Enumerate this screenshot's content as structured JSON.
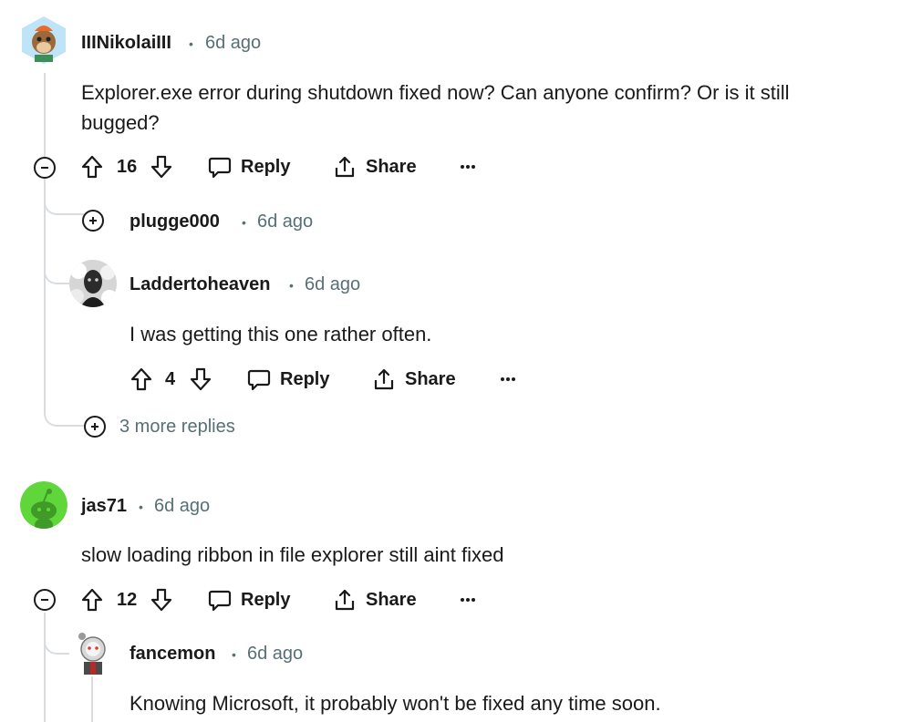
{
  "comments": [
    {
      "username": "IIINikolaiIII",
      "time": "6d ago",
      "body_lines": [
        "Explorer.exe error during shutdown fixed now? Can anyone confirm? Or is it still",
        "bugged?"
      ],
      "votes": "16",
      "reply_label": "Reply",
      "share_label": "Share"
    },
    {
      "username": "plugge000",
      "time": "6d ago",
      "collapsed": true
    },
    {
      "username": "Laddertoheaven",
      "time": "6d ago",
      "body": "I was getting this one rather often.",
      "votes": "4",
      "reply_label": "Reply",
      "share_label": "Share"
    },
    {
      "more_replies": "3 more replies"
    },
    {
      "username": "jas71",
      "time": "6d ago",
      "body": "slow loading ribbon in file explorer still aint fixed",
      "votes": "12",
      "reply_label": "Reply",
      "share_label": "Share"
    },
    {
      "username": "fancemon",
      "time": "6d ago",
      "body": "Knowing Microsoft, it probably won't be fixed any time soon."
    }
  ],
  "separator": "•",
  "colors": {
    "text": "#1a1a1b",
    "meta": "#576f76",
    "threadline": "#dadde0",
    "snoo_green": "#5fd63a"
  },
  "icons": [
    "upvote-icon",
    "downvote-icon",
    "comment-icon",
    "share-icon",
    "more-icon",
    "collapse-icon",
    "expand-icon"
  ]
}
